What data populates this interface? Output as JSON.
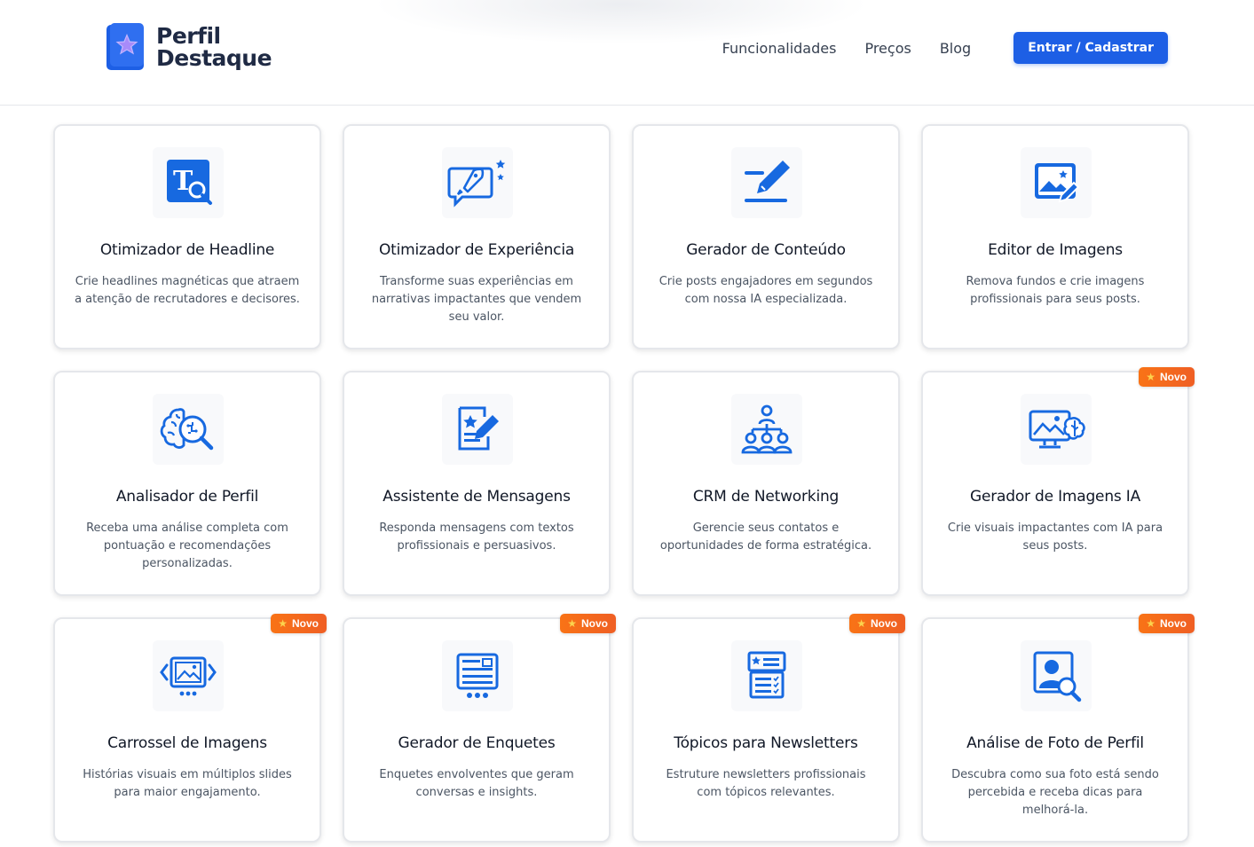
{
  "brand": {
    "line1": "Perfil",
    "line2": "Destaque"
  },
  "nav": {
    "links": [
      "Funcionalidades",
      "Preços",
      "Blog"
    ],
    "cta": "Entrar / Cadastrar"
  },
  "colors": {
    "accent": "#1d5fe5",
    "badge": "#f97316",
    "icon": "#1769e0"
  },
  "features": [
    {
      "title": "Otimizador de Headline",
      "description": "Crie headlines magnéticas que atraem a atenção de recrutadores e decisores.",
      "icon": "headline-icon",
      "badge": ""
    },
    {
      "title": "Otimizador de Experiência",
      "description": "Transforme suas experiências em narrativas impactantes que vendem seu valor.",
      "icon": "rocket-icon",
      "badge": ""
    },
    {
      "title": "Gerador de Conteúdo",
      "description": "Crie posts engajadores em segundos com nossa IA especializada.",
      "icon": "pen-icon",
      "badge": ""
    },
    {
      "title": "Editor de Imagens",
      "description": "Remova fundos e crie imagens profissionais para seus posts.",
      "icon": "image-edit-icon",
      "badge": ""
    },
    {
      "title": "Analisador de Perfil",
      "description": "Receba uma análise completa com pontuação e recomendações personalizadas.",
      "icon": "brain-search-icon",
      "badge": ""
    },
    {
      "title": "Assistente de Mensagens",
      "description": "Responda mensagens com textos profissionais e persuasivos.",
      "icon": "message-doc-icon",
      "badge": ""
    },
    {
      "title": "CRM de Networking",
      "description": "Gerencie seus contatos e oportunidades de forma estratégica.",
      "icon": "network-icon",
      "badge": ""
    },
    {
      "title": "Gerador de Imagens IA",
      "description": "Crie visuais impactantes com IA para seus posts.",
      "icon": "ai-image-icon",
      "badge": "Novo"
    },
    {
      "title": "Carrossel de Imagens",
      "description": "Histórias visuais em múltiplos slides para maior engajamento.",
      "icon": "carousel-icon",
      "badge": "Novo"
    },
    {
      "title": "Gerador de Enquetes",
      "description": "Enquetes envolventes que geram conversas e insights.",
      "icon": "poll-icon",
      "badge": "Novo"
    },
    {
      "title": "Tópicos para Newsletters",
      "description": "Estruture newsletters profissionais com tópicos relevantes.",
      "icon": "newsletter-icon",
      "badge": "Novo"
    },
    {
      "title": "Análise de Foto de Perfil",
      "description": "Descubra como sua foto está sendo percebida e receba dicas para melhorá-la.",
      "icon": "photo-analysis-icon",
      "badge": "Novo"
    }
  ]
}
